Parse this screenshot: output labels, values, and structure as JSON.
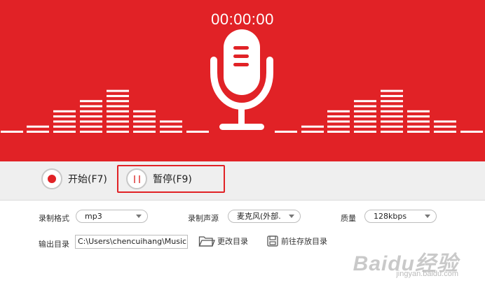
{
  "recorder": {
    "timer": "00:00:00",
    "start_label": "开始(F7)",
    "pause_label": "暂停(F9)"
  },
  "settings": {
    "format_label": "录制格式",
    "format_value": "mp3",
    "source_label": "录制声源",
    "source_value": "麦克风(外部.",
    "quality_label": "质量",
    "quality_value": "128kbps",
    "output_label": "输出目录",
    "output_path": "C:\\Users\\chencuihang\\Music",
    "change_dir_label": "更改目录",
    "open_dir_label": "前往存放目录"
  },
  "watermark": {
    "logo": "Baidu经验",
    "site": "jingyan.baidu.com"
  },
  "colors": {
    "accent": "#e12226",
    "background": "#ffffff",
    "toolbar": "#efefef"
  },
  "icons": [
    "microphone-icon",
    "record-dot-icon",
    "pause-icon",
    "folder-icon",
    "save-icon",
    "chevron-down-icon"
  ]
}
